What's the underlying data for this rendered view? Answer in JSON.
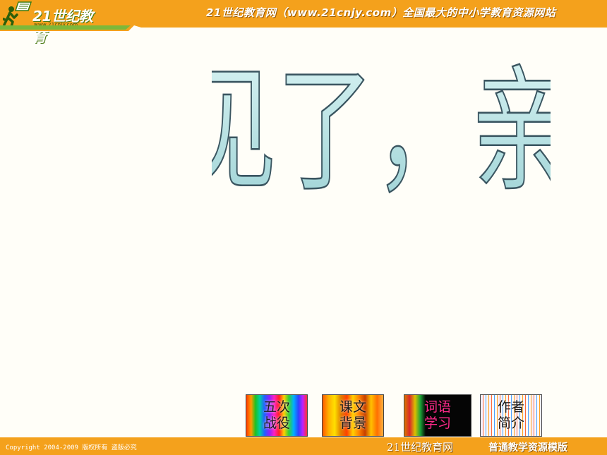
{
  "header": {
    "logo_text": "21世纪教育",
    "logo_url": "www.21cnjy.com",
    "title": "21世纪教育网（www.21cnjy.com）全国最大的中小学教育资源网站"
  },
  "slide": {
    "title": "再见了，亲人"
  },
  "nav": {
    "btn1": {
      "line1": "五次",
      "line2": "战役"
    },
    "btn2": {
      "line1": "课文",
      "line2": "背景"
    },
    "btn3": {
      "line1": "词语",
      "line2": "学习"
    },
    "btn4": {
      "line1": "作者",
      "line2": "简介"
    }
  },
  "footer": {
    "copyright": "Copyright 2004-2009 版权所有 盗版必究",
    "brand": "21世纪教育网",
    "tag": "普通教学资源模版"
  },
  "colors": {
    "header_orange": "#f4a11c",
    "wordart_fill": "#b9e3e3",
    "wordart_stroke": "#3a5560"
  }
}
